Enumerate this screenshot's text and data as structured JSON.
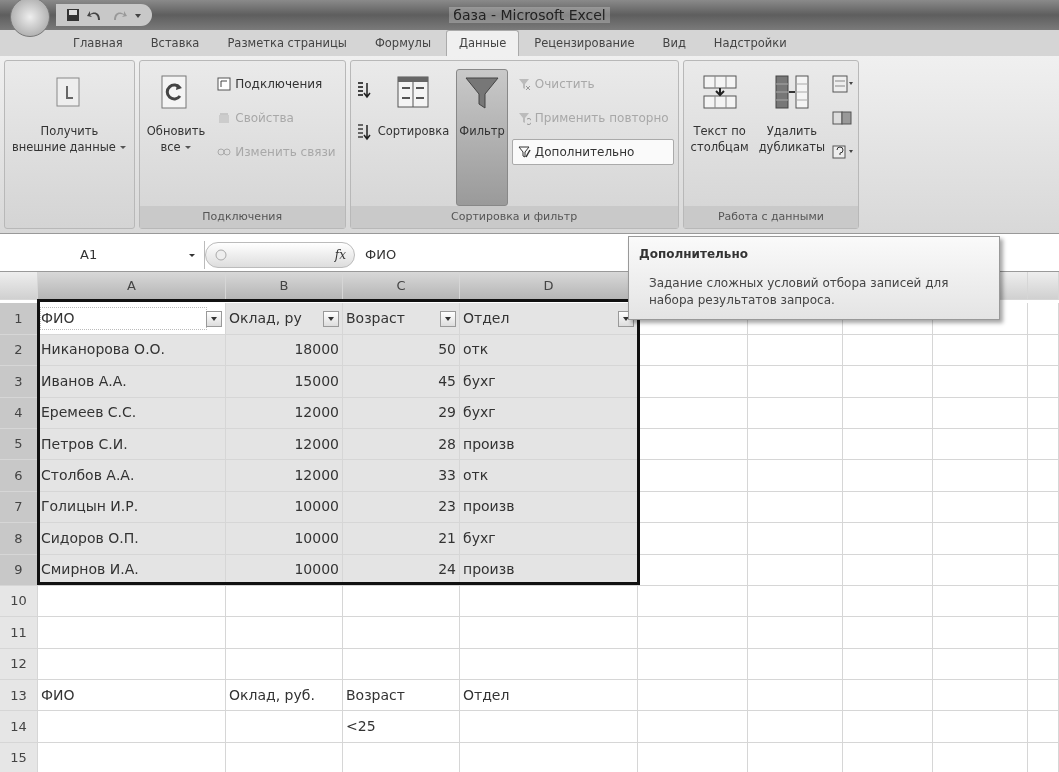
{
  "window": {
    "title": "база - Microsoft Excel"
  },
  "tabs": [
    {
      "label": "Главная",
      "selected": false
    },
    {
      "label": "Вставка",
      "selected": false
    },
    {
      "label": "Разметка страницы",
      "selected": false
    },
    {
      "label": "Формулы",
      "selected": false
    },
    {
      "label": "Данные",
      "selected": true
    },
    {
      "label": "Рецензирование",
      "selected": false
    },
    {
      "label": "Вид",
      "selected": false
    },
    {
      "label": "Надстройки",
      "selected": false
    }
  ],
  "ribbon_groups": [
    {
      "items": [
        {
          "kind": "large",
          "lines": [
            "Получить",
            "внешние данные"
          ],
          "dropdown": true,
          "pressed": false
        }
      ]
    },
    {
      "label": "Подключения",
      "items": [
        {
          "kind": "large",
          "lines": [
            "Обновить",
            "все"
          ],
          "dropdown": true,
          "pressed": false
        },
        {
          "kind": "stack",
          "entries": [
            {
              "label": "Подключения",
              "disabled": false,
              "hovered": false
            },
            {
              "label": "Свойства",
              "disabled": true,
              "hovered": false
            },
            {
              "label": "Изменить связи",
              "disabled": true,
              "hovered": false
            }
          ]
        }
      ]
    },
    {
      "label": "Сортировка и фильтр",
      "items": [
        {
          "kind": "sort-pair"
        },
        {
          "kind": "large",
          "lines": [
            "Сортировка"
          ],
          "dropdown": false,
          "pressed": false
        },
        {
          "kind": "large",
          "lines": [
            "Фильтр"
          ],
          "dropdown": false,
          "pressed": true
        },
        {
          "kind": "stack",
          "entries": [
            {
              "label": "Очистить",
              "disabled": true,
              "hovered": false
            },
            {
              "label": "Применить повторно",
              "disabled": true,
              "hovered": false
            },
            {
              "label": "Дополнительно",
              "disabled": false,
              "hovered": true
            }
          ]
        }
      ]
    },
    {
      "label": "Работа с данными",
      "items": [
        {
          "kind": "large",
          "lines": [
            "Текст по",
            "столбцам"
          ],
          "dropdown": false,
          "pressed": false
        },
        {
          "kind": "large",
          "lines": [
            "Удалить",
            "дубликаты"
          ],
          "dropdown": false,
          "pressed": false
        },
        {
          "kind": "icon-stack"
        }
      ]
    }
  ],
  "formula_bar": {
    "name_box": "A1",
    "function_label": "fx",
    "value": "ФИО"
  },
  "sheet": {
    "columns": [
      {
        "label": "A",
        "selected": true
      },
      {
        "label": "B",
        "selected": true
      },
      {
        "label": "C",
        "selected": true
      },
      {
        "label": "D",
        "selected": true
      }
    ],
    "rows": [
      {
        "number": "1",
        "kind": "filter-header",
        "selected": true,
        "cells": [
          {
            "text": "ФИО",
            "active": true
          },
          {
            "text": "Оклад, ру",
            "active": false
          },
          {
            "text": "Возраст",
            "active": false
          },
          {
            "text": "Отдел",
            "active": false
          }
        ]
      },
      {
        "number": "2",
        "kind": "data",
        "selected": true,
        "cells": [
          {
            "text": "Никанорова О.О.",
            "active": false
          },
          {
            "text": "18000",
            "active": false
          },
          {
            "text": "50",
            "active": false
          },
          {
            "text": "отк",
            "active": false
          }
        ]
      },
      {
        "number": "3",
        "kind": "data",
        "selected": true,
        "cells": [
          {
            "text": "Иванов А.А.",
            "active": false
          },
          {
            "text": "15000",
            "active": false
          },
          {
            "text": "45",
            "active": false
          },
          {
            "text": "бухг",
            "active": false
          }
        ]
      },
      {
        "number": "4",
        "kind": "data",
        "selected": true,
        "cells": [
          {
            "text": "Еремеев С.С.",
            "active": false
          },
          {
            "text": "12000",
            "active": false
          },
          {
            "text": "29",
            "active": false
          },
          {
            "text": "бухг",
            "active": false
          }
        ]
      },
      {
        "number": "5",
        "kind": "data",
        "selected": true,
        "cells": [
          {
            "text": "Петров С.И.",
            "active": false
          },
          {
            "text": "12000",
            "active": false
          },
          {
            "text": "28",
            "active": false
          },
          {
            "text": "произв",
            "active": false
          }
        ]
      },
      {
        "number": "6",
        "kind": "data",
        "selected": true,
        "cells": [
          {
            "text": "Столбов А.А.",
            "active": false
          },
          {
            "text": "12000",
            "active": false
          },
          {
            "text": "33",
            "active": false
          },
          {
            "text": "отк",
            "active": false
          }
        ]
      },
      {
        "number": "7",
        "kind": "data",
        "selected": true,
        "cells": [
          {
            "text": "Голицын И.Р.",
            "active": false
          },
          {
            "text": "10000",
            "active": false
          },
          {
            "text": "23",
            "active": false
          },
          {
            "text": "произв",
            "active": false
          }
        ]
      },
      {
        "number": "8",
        "kind": "data",
        "selected": true,
        "cells": [
          {
            "text": "Сидоров О.П.",
            "active": false
          },
          {
            "text": "10000",
            "active": false
          },
          {
            "text": "21",
            "active": false
          },
          {
            "text": "бухг",
            "active": false
          }
        ]
      },
      {
        "number": "9",
        "kind": "data",
        "selected": true,
        "cells": [
          {
            "text": "Смирнов И.А.",
            "active": false
          },
          {
            "text": "10000",
            "active": false
          },
          {
            "text": "24",
            "active": false
          },
          {
            "text": "произв",
            "active": false
          }
        ]
      },
      {
        "number": "10",
        "kind": "plain",
        "selected": false
      },
      {
        "number": "11",
        "kind": "plain",
        "selected": false
      },
      {
        "number": "12",
        "kind": "plain",
        "selected": false
      },
      {
        "number": "13",
        "kind": "plain",
        "selected": false,
        "cells": [
          {
            "text": "ФИО",
            "active": false
          },
          {
            "text": "Оклад, руб.",
            "active": false
          },
          {
            "text": "Возраст",
            "active": false
          },
          {
            "text": "Отдел",
            "active": false
          }
        ]
      },
      {
        "number": "14",
        "kind": "plain",
        "selected": false,
        "cells": [
          null,
          null,
          {
            "text": "<25",
            "active": false
          },
          null
        ]
      },
      {
        "number": "15",
        "kind": "plain",
        "selected": false
      }
    ]
  },
  "tooltip": {
    "title": "Дополнительно",
    "text": "Задание сложных условий отбора записей для набора результатов запроса."
  }
}
